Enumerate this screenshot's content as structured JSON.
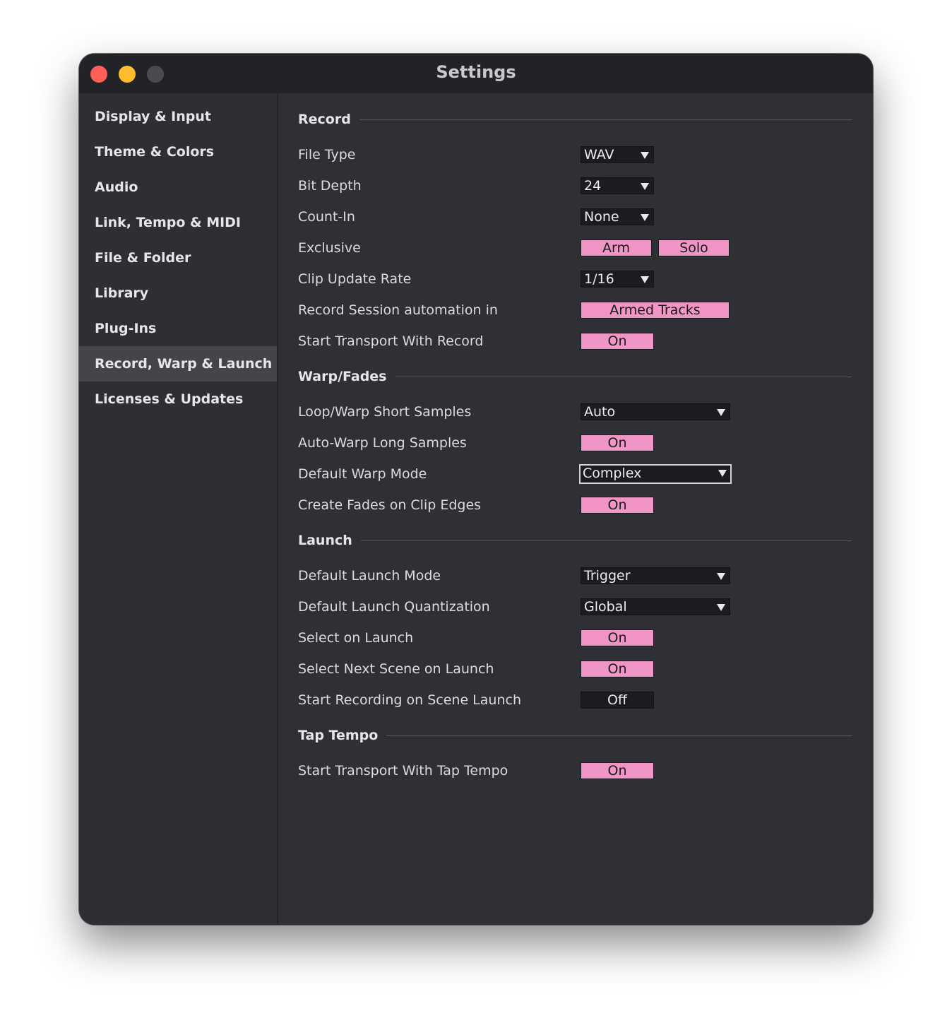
{
  "window": {
    "title": "Settings"
  },
  "sidebar": {
    "items": [
      {
        "label": "Display & Input"
      },
      {
        "label": "Theme & Colors"
      },
      {
        "label": "Audio"
      },
      {
        "label": "Link, Tempo & MIDI"
      },
      {
        "label": "File & Folder"
      },
      {
        "label": "Library"
      },
      {
        "label": "Plug-Ins"
      },
      {
        "label": "Record, Warp & Launch",
        "selected": true
      },
      {
        "label": "Licenses & Updates"
      }
    ]
  },
  "record": {
    "title": "Record",
    "file_type": {
      "label": "File Type",
      "value": "WAV"
    },
    "bit_depth": {
      "label": "Bit Depth",
      "value": "24"
    },
    "count_in": {
      "label": "Count-In",
      "value": "None"
    },
    "exclusive": {
      "label": "Exclusive",
      "arm": "Arm",
      "solo": "Solo",
      "arm_on": true,
      "solo_on": true
    },
    "clip_update_rate": {
      "label": "Clip Update Rate",
      "value": "1/16"
    },
    "session_automation": {
      "label": "Record Session automation in",
      "value": "Armed Tracks"
    },
    "start_transport": {
      "label": "Start Transport With Record",
      "value": "On"
    }
  },
  "warp": {
    "title": "Warp/Fades",
    "loop_warp_short": {
      "label": "Loop/Warp Short Samples",
      "value": "Auto"
    },
    "auto_warp_long": {
      "label": "Auto-Warp Long Samples",
      "value": "On"
    },
    "default_warp_mode": {
      "label": "Default Warp Mode",
      "value": "Complex"
    },
    "create_fades": {
      "label": "Create Fades on Clip Edges",
      "value": "On"
    }
  },
  "launch": {
    "title": "Launch",
    "default_launch_mode": {
      "label": "Default Launch Mode",
      "value": "Trigger"
    },
    "default_launch_quantization": {
      "label": "Default Launch Quantization",
      "value": "Global"
    },
    "select_on_launch": {
      "label": "Select on Launch",
      "value": "On"
    },
    "select_next_scene": {
      "label": "Select Next Scene on Launch",
      "value": "On"
    },
    "start_recording_scene": {
      "label": "Start Recording on Scene Launch",
      "value": "Off"
    }
  },
  "tap_tempo": {
    "title": "Tap Tempo",
    "start_transport_tap": {
      "label": "Start Transport With Tap Tempo",
      "value": "On"
    }
  },
  "colors": {
    "toggle_on": "#f095c5",
    "toggle_off": "#1b1c1f",
    "background": "#2f3035",
    "titlebar": "#222327",
    "sidebar_selected": "#44454b"
  }
}
